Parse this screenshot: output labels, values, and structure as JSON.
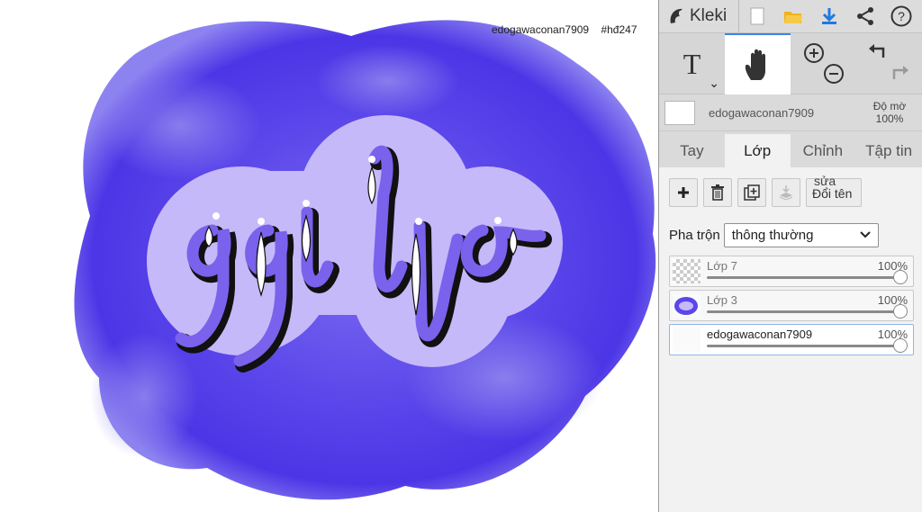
{
  "canvas": {
    "watermark_user": "edogawaconan7909",
    "watermark_tag": "#hđ247"
  },
  "app": {
    "name": "Kleki"
  },
  "toolbar": {
    "icons": [
      "new-file-icon",
      "open-folder-icon",
      "download-icon",
      "share-icon",
      "help-icon"
    ]
  },
  "tools": {
    "text_label": "T",
    "active": "hand"
  },
  "color_row": {
    "layer_name": "edogawaconan7909",
    "opacity_label": "Độ mờ",
    "opacity_value": "100%"
  },
  "tabs": [
    {
      "label": "Tay"
    },
    {
      "label": "Lớp"
    },
    {
      "label": "Chỉnh"
    },
    {
      "label": "Tập tin"
    }
  ],
  "active_tab": "Lớp",
  "layer_buttons": {
    "rename_top": "sửa",
    "rename_label": "Đổi tên"
  },
  "blend": {
    "label": "Pha trộn",
    "value": "thông thường"
  },
  "layers": [
    {
      "name": "Lớp 7",
      "opacity": "100%"
    },
    {
      "name": "Lớp 3",
      "opacity": "100%"
    },
    {
      "name": "edogawaconan7909",
      "opacity": "100%"
    }
  ],
  "colors": {
    "accent": "#3f84e5",
    "purple_deep": "#4a36e8",
    "purple_light": "#c7b8f8"
  }
}
